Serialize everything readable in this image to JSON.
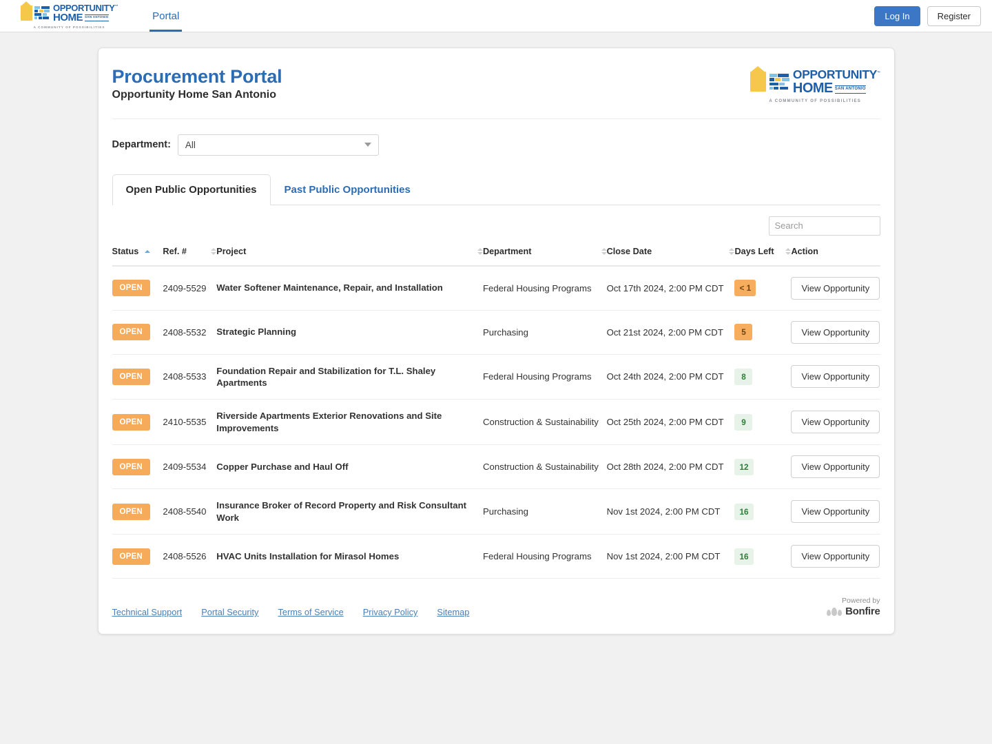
{
  "brand": {
    "logo_word_1": "OPPORTUNITY",
    "logo_word_2": "HOME",
    "logo_region": "SAN ANTONIO",
    "logo_tagline": "A COMMUNITY OF POSSIBILITIES",
    "accent_blue": "#2b6cb3",
    "accent_yellow": "#f5c84c"
  },
  "topnav": {
    "portal_tab": "Portal",
    "login_label": "Log In",
    "register_label": "Register"
  },
  "header": {
    "title": "Procurement Portal",
    "subtitle": "Opportunity Home San Antonio"
  },
  "filter": {
    "label": "Department:",
    "selected": "All"
  },
  "tabs": [
    {
      "label": "Open Public Opportunities",
      "active": true
    },
    {
      "label": "Past Public Opportunities",
      "active": false
    }
  ],
  "search": {
    "placeholder": "Search",
    "value": ""
  },
  "table": {
    "columns": [
      {
        "label": "Status",
        "sort": "asc"
      },
      {
        "label": "Ref. #",
        "sort": "none"
      },
      {
        "label": "Project",
        "sort": "none"
      },
      {
        "label": "Department",
        "sort": "none"
      },
      {
        "label": "Close Date",
        "sort": "none"
      },
      {
        "label": "Days Left",
        "sort": "none"
      },
      {
        "label": "Action",
        "sort": null
      }
    ],
    "action_label": "View Opportunity",
    "rows": [
      {
        "status": "OPEN",
        "ref": "2409-5529",
        "project": "Water Softener Maintenance, Repair, and Installation",
        "department": "Federal Housing Programs",
        "close_date": "Oct 17th 2024, 2:00 PM CDT",
        "days_left": "< 1",
        "days_level": "warn"
      },
      {
        "status": "OPEN",
        "ref": "2408-5532",
        "project": "Strategic Planning",
        "department": "Purchasing",
        "close_date": "Oct 21st 2024, 2:00 PM CDT",
        "days_left": "5",
        "days_level": "warn"
      },
      {
        "status": "OPEN",
        "ref": "2408-5533",
        "project": "Foundation Repair and Stabilization for T.L. Shaley Apartments",
        "department": "Federal Housing Programs",
        "close_date": "Oct 24th 2024, 2:00 PM CDT",
        "days_left": "8",
        "days_level": "ok"
      },
      {
        "status": "OPEN",
        "ref": "2410-5535",
        "project": "Riverside Apartments Exterior Renovations and Site Improvements",
        "department": "Construction & Sustainability",
        "close_date": "Oct 25th 2024, 2:00 PM CDT",
        "days_left": "9",
        "days_level": "ok"
      },
      {
        "status": "OPEN",
        "ref": "2409-5534",
        "project": "Copper Purchase and Haul Off",
        "department": "Construction & Sustainability",
        "close_date": "Oct 28th 2024, 2:00 PM CDT",
        "days_left": "12",
        "days_level": "ok"
      },
      {
        "status": "OPEN",
        "ref": "2408-5540",
        "project": "Insurance Broker of Record Property and Risk Consultant Work",
        "department": "Purchasing",
        "close_date": "Nov 1st 2024, 2:00 PM CDT",
        "days_left": "16",
        "days_level": "ok"
      },
      {
        "status": "OPEN",
        "ref": "2408-5526",
        "project": "HVAC Units Installation for Mirasol Homes",
        "department": "Federal Housing Programs",
        "close_date": "Nov 1st 2024, 2:00 PM CDT",
        "days_left": "16",
        "days_level": "ok"
      }
    ]
  },
  "footer": {
    "links": [
      "Technical Support",
      "Portal Security",
      "Terms of Service",
      "Privacy Policy",
      "Sitemap"
    ],
    "powered_by": "Powered by",
    "powered_brand": "Bonfire"
  }
}
